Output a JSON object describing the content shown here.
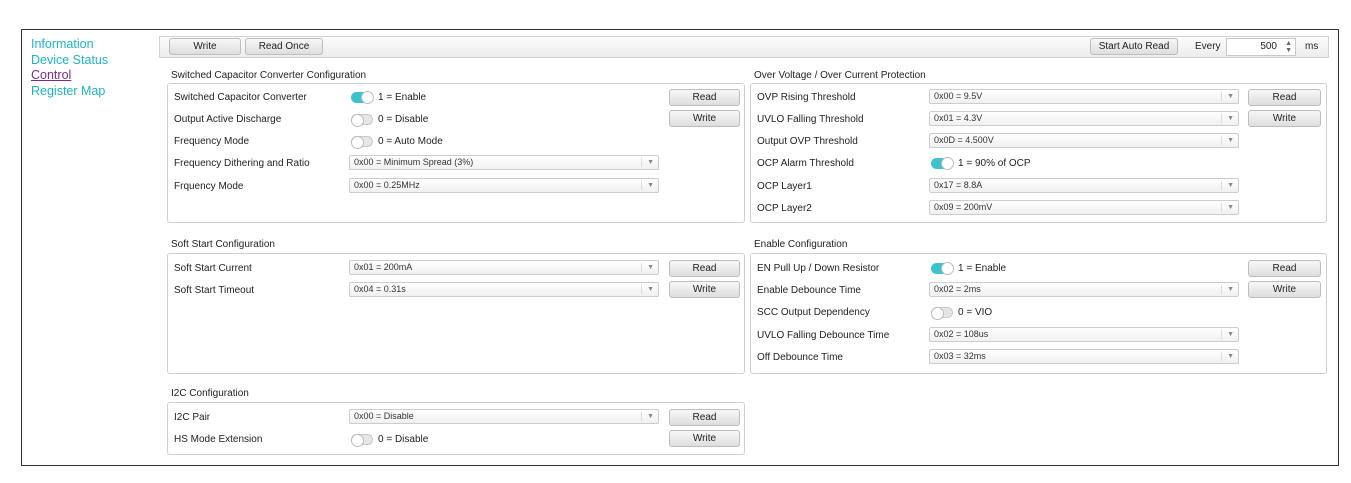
{
  "nav": {
    "items": [
      {
        "label": "Information"
      },
      {
        "label": "Device Status"
      },
      {
        "label": "Control"
      },
      {
        "label": "Register Map"
      }
    ]
  },
  "toolbar": {
    "write_label": "Write",
    "read_once_label": "Read Once",
    "start_auto_read_label": "Start Auto Read",
    "every_label": "Every",
    "interval_value": "500",
    "interval_unit": "ms"
  },
  "common": {
    "read_label": "Read",
    "write_label": "Write"
  },
  "scc": {
    "title": "Switched Capacitor Converter Configuration",
    "rows": {
      "converter": {
        "label": "Switched Capacitor Converter",
        "value": "1 = Enable"
      },
      "discharge": {
        "label": "Output Active Discharge",
        "value": "0 = Disable"
      },
      "freq_mode": {
        "label": "Frequency Mode",
        "value": "0 = Auto Mode"
      },
      "dither": {
        "label": "Frequency Dithering and Ratio",
        "value": "0x00 = Minimum Spread (3%)"
      },
      "frq_mode": {
        "label": "Frquency Mode",
        "value": "0x00 = 0.25MHz"
      }
    }
  },
  "ovp": {
    "title": "Over Voltage / Over Current Protection",
    "rows": {
      "ovp_rising": {
        "label": "OVP Rising Threshold",
        "value": "0x00 = 9.5V"
      },
      "uvlo_falling": {
        "label": "UVLO Falling Threshold",
        "value": "0x01 = 4.3V"
      },
      "output_ovp": {
        "label": "Output OVP Threshold",
        "value": "0x0D = 4.500V"
      },
      "ocp_alarm": {
        "label": "OCP Alarm Threshold",
        "value": "1 = 90% of OCP"
      },
      "ocp_layer1": {
        "label": "OCP Layer1",
        "value": "0x17 = 8.8A"
      },
      "ocp_layer2": {
        "label": "OCP Layer2",
        "value": "0x09 = 200mV"
      }
    }
  },
  "soft_start": {
    "title": "Soft Start Configuration",
    "rows": {
      "current": {
        "label": "Soft Start Current",
        "value": "0x01 = 200mA"
      },
      "timeout": {
        "label": "Soft Start Timeout",
        "value": "0x04 = 0.31s"
      }
    }
  },
  "enable": {
    "title": "Enable Configuration",
    "rows": {
      "en_pull": {
        "label": "EN Pull Up / Down Resistor",
        "value": "1 = Enable"
      },
      "debounce": {
        "label": "Enable Debounce Time",
        "value": "0x02 = 2ms"
      },
      "scc_dep": {
        "label": "SCC Output Dependency",
        "value": "0 = VIO"
      },
      "uvlo_deb": {
        "label": "UVLO Falling Debounce Time",
        "value": "0x02 = 108us"
      },
      "off_deb": {
        "label": "Off Debounce Time",
        "value": "0x03 = 32ms"
      }
    }
  },
  "i2c": {
    "title": "I2C Configuration",
    "rows": {
      "pair": {
        "label": "I2C Pair",
        "value": "0x00 = Disable"
      },
      "hs_mode": {
        "label": "HS Mode Extension",
        "value": "0 = Disable"
      }
    }
  },
  "colors": {
    "nav_link": "#1fb3c4",
    "nav_active": "#7a2a8a",
    "toggle_on": "#3cc3cf"
  }
}
